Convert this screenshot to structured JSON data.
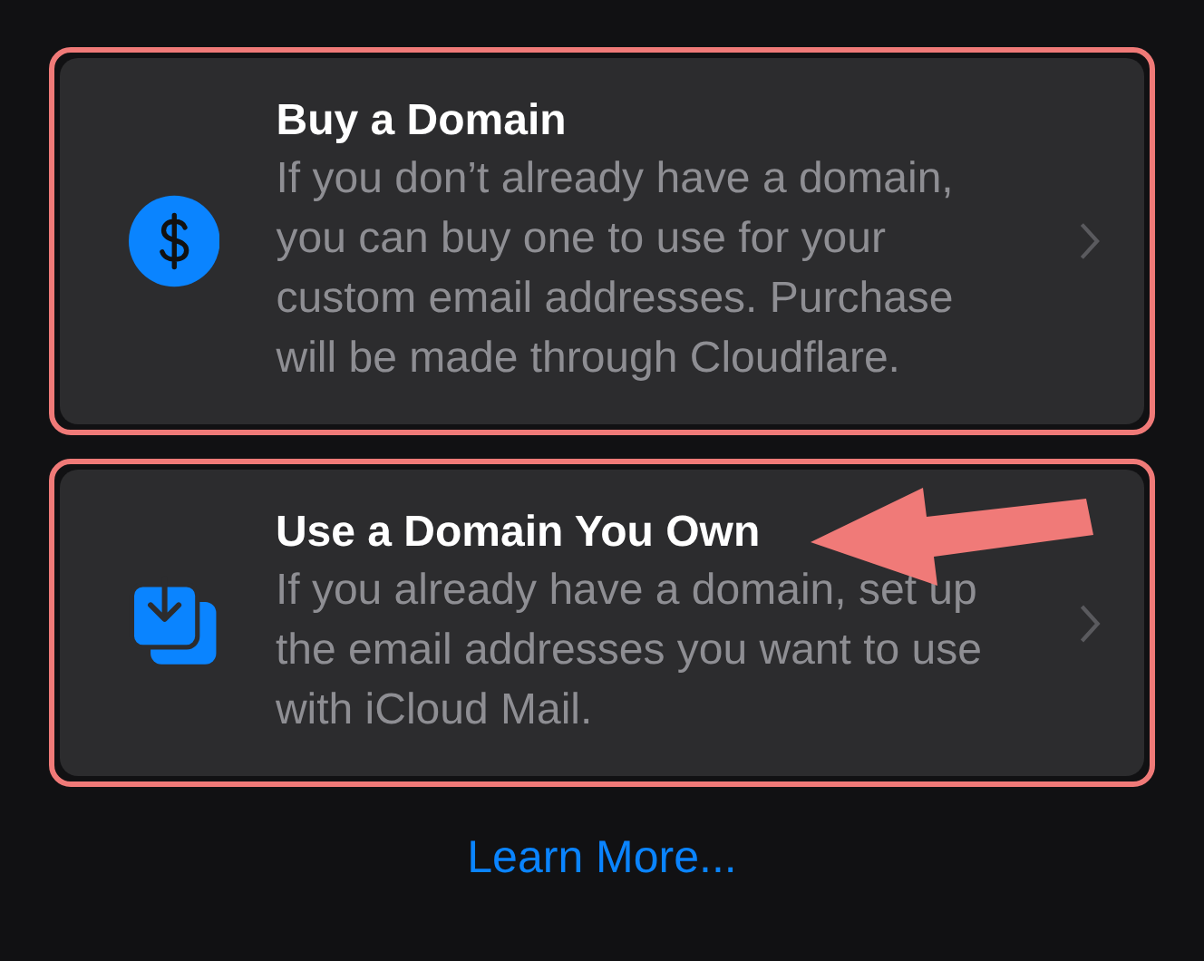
{
  "options": [
    {
      "kind": "buy",
      "title": "Buy a Domain",
      "description": "If you don’t already have a domain, you can buy one to use for your custom email addresses. Purchase will be made through Cloudflare.",
      "highlighted": true,
      "pointed": false
    },
    {
      "kind": "own",
      "title": "Use a Domain You Own",
      "description": "If you already have a domain, set up the email addresses you want to use with iCloud Mail.",
      "highlighted": true,
      "pointed": true
    }
  ],
  "link": "Learn More..."
}
